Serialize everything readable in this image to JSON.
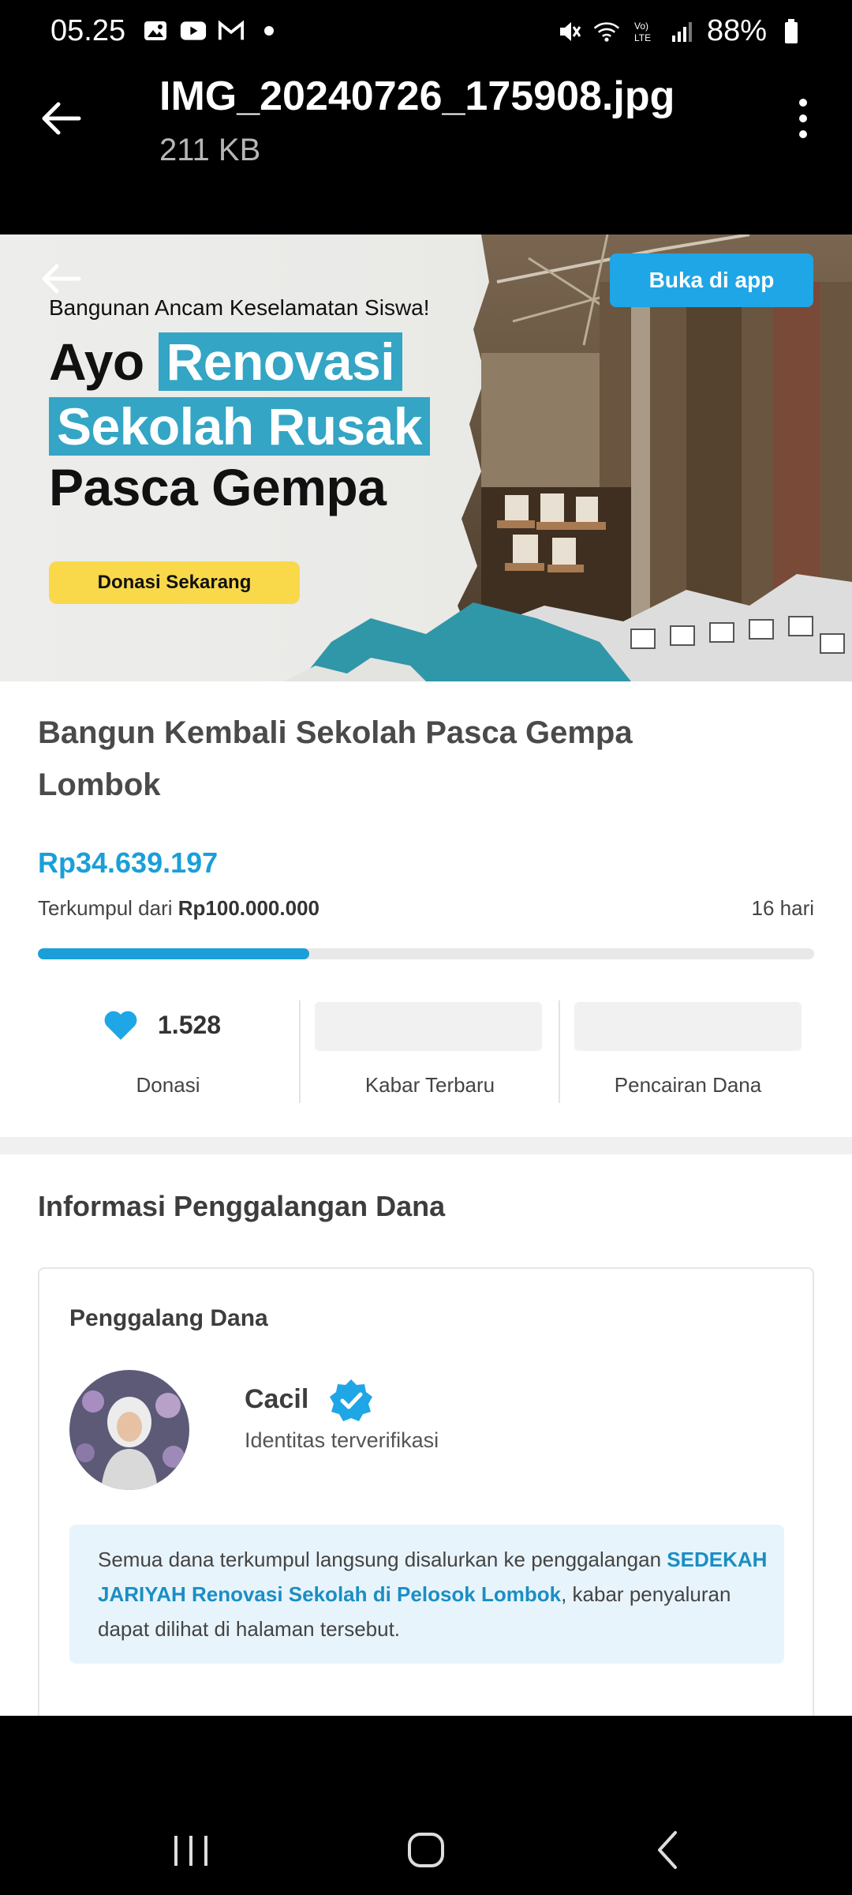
{
  "status_bar": {
    "time": "05.25",
    "battery": "88%",
    "icons": [
      "gallery-icon",
      "youtube-icon",
      "gmail-icon",
      "dot-icon",
      "mute-icon",
      "wifi-icon",
      "volte-icon",
      "signal-icon",
      "battery-icon"
    ]
  },
  "viewer": {
    "file_name": "IMG_20240726_175908.jpg",
    "file_size": "211 KB"
  },
  "banner": {
    "open_app_label": "Buka di app",
    "tagline": "Bangunan Ancam Keselamatan Siswa!",
    "headline": {
      "line1_plain": "Ayo",
      "line1_highlight": "Renovasi",
      "line2_highlight": "Sekolah Rusak",
      "line3": "Pasca Gempa"
    },
    "donate_label": "Donasi Sekarang",
    "accent_color": "#34a5c4",
    "button_color": "#f9d94a"
  },
  "campaign": {
    "title": "Bangun Kembali Sekolah Pasca Gempa Lombok",
    "raised": "Rp34.639.197",
    "target_prefix": "Terkumpul dari",
    "target_amount": "Rp100.000.000",
    "days_left": "16 hari",
    "progress_fraction": 0.35,
    "progress_color": "#1a9fd8"
  },
  "stats": {
    "donor_count": "1.528",
    "donations_label": "Donasi",
    "updates_label": "Kabar Terbaru",
    "disbursement_label": "Pencairan Dana"
  },
  "info": {
    "heading": "Informasi Penggalangan Dana",
    "card_label": "Penggalang Dana",
    "fundraiser_name": "Cacil",
    "verified_text": "Identitas terverifikasi",
    "note_before": "Semua dana terkumpul langsung disalurkan ke penggalangan ",
    "note_link": "SEDEKAH JARIYAH Renovasi Sekolah di Pelosok Lombok",
    "note_after": ", kabar penyaluran dapat dilihat di halaman tersebut."
  }
}
